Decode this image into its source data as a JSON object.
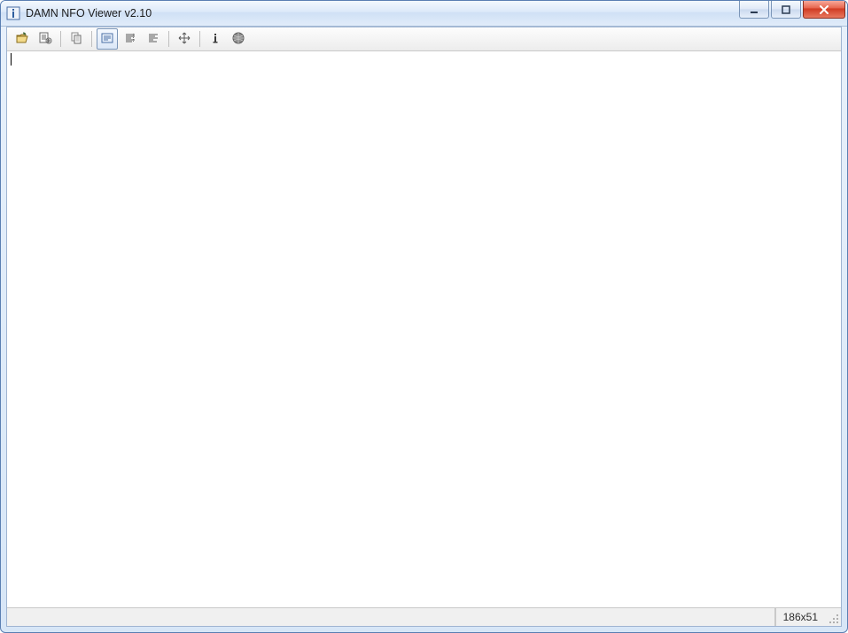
{
  "window": {
    "title": "DAMN NFO Viewer v2.10"
  },
  "toolbar": {
    "items": [
      {
        "name": "open-icon"
      },
      {
        "name": "shell-integration-icon"
      },
      {
        "sep": true
      },
      {
        "name": "copy-icon"
      },
      {
        "sep": true
      },
      {
        "name": "wrap-window-icon",
        "active": true
      },
      {
        "name": "wrap-fixed-icon"
      },
      {
        "name": "wrap-none-icon"
      },
      {
        "sep": true
      },
      {
        "name": "autosize-icon"
      },
      {
        "sep": true
      },
      {
        "name": "about-icon"
      },
      {
        "name": "homepage-icon"
      }
    ]
  },
  "viewer": {
    "content": ""
  },
  "status": {
    "dimensions": "186x51"
  }
}
